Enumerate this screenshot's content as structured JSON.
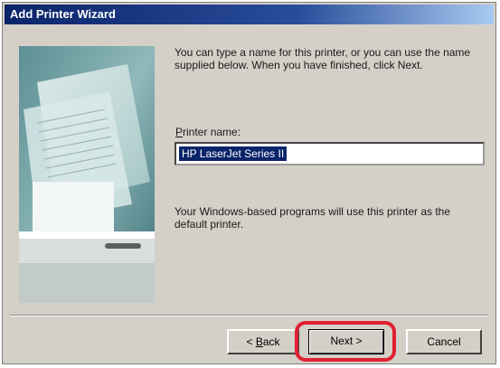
{
  "window": {
    "title": "Add Printer Wizard"
  },
  "content": {
    "intro_text": "You can type a name for this printer, or you can use the name supplied below. When you have finished, click Next.",
    "printer_name_label_accel": "P",
    "printer_name_label_rest": "rinter name:",
    "printer_name_value": "HP LaserJet Series II",
    "note_text": "Your Windows-based programs will use this printer as the default printer."
  },
  "buttons": {
    "back_lt": "< ",
    "back_accel": "B",
    "back_rest": "ack",
    "next_label": "Next >",
    "cancel_label": "Cancel"
  },
  "colors": {
    "highlight": "#e02030",
    "title_bar": "#0a246a",
    "selection": "#0a246a"
  }
}
